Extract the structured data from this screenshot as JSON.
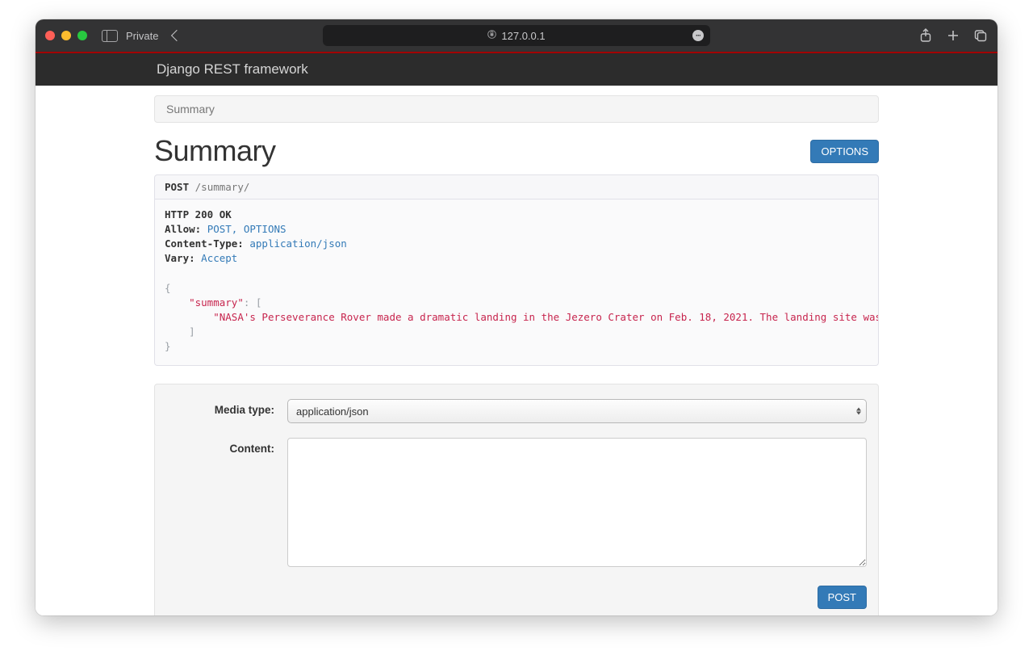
{
  "browser": {
    "private_label": "Private",
    "url": "127.0.0.1",
    "reader_badge": "···"
  },
  "navbar": {
    "brand": "Django REST framework"
  },
  "breadcrumb": {
    "current": "Summary"
  },
  "page": {
    "title": "Summary",
    "options_button": "OPTIONS"
  },
  "request": {
    "verb": "POST",
    "path": "/summary/"
  },
  "response": {
    "status_line": "HTTP 200 OK",
    "headers": {
      "allow_key": "Allow:",
      "allow_value": "POST, OPTIONS",
      "ctype_key": "Content-Type:",
      "ctype_value": "application/json",
      "vary_key": "Vary:",
      "vary_value": "Accept"
    },
    "body": {
      "open": "{",
      "key": "\"summary\"",
      "colon": ": [",
      "value": "\"NASA's Perseverance Rover made a dramatic landing in the Jezero Crater on Feb. 18, 2021. The landing site was chosen for its potential to host signs",
      "close_arr": "    ]",
      "close": "}"
    }
  },
  "form": {
    "media_type_label": "Media type:",
    "media_type_value": "application/json",
    "content_label": "Content:",
    "content_value": "",
    "post_button": "POST"
  }
}
